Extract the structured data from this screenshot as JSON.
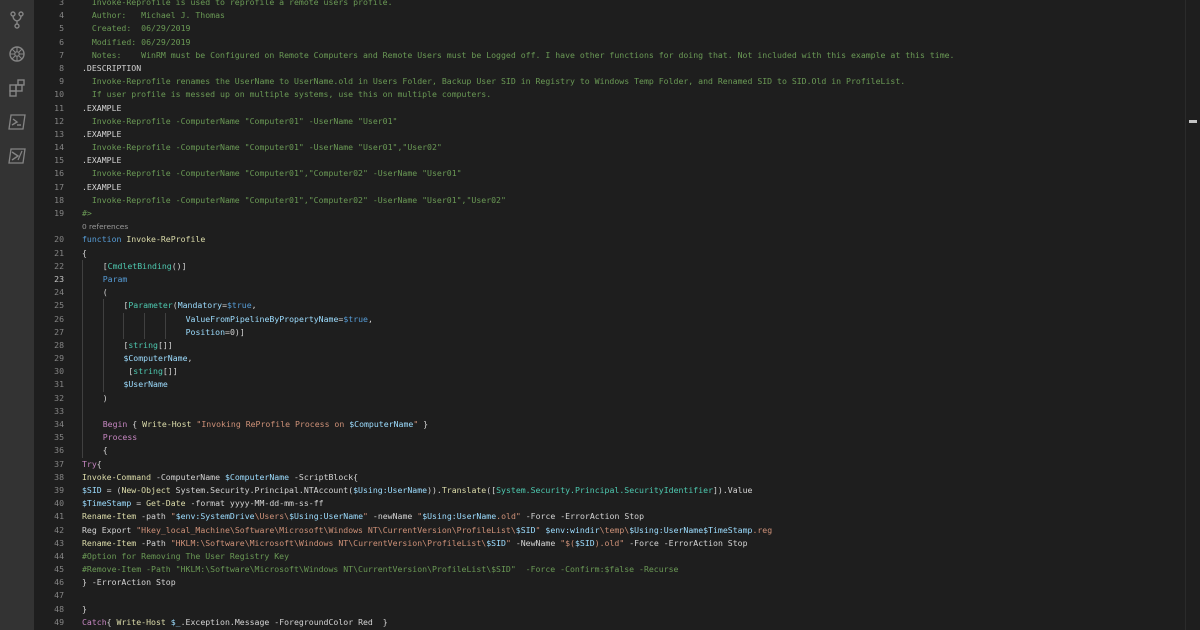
{
  "activity_bar": {
    "icons": [
      "source-control-icon",
      "debug-icon",
      "extensions-icon",
      "powershell-icon",
      "powershell-alt-icon"
    ]
  },
  "colors": {
    "background": "#1e1e1e",
    "comment": "#6a9955",
    "keyword": "#569cd6",
    "control": "#c586c0",
    "function": "#dcdcaa",
    "variable": "#9cdcfe",
    "string": "#ce9178",
    "type": "#4ec9b0"
  },
  "editor": {
    "active_line": "23",
    "codelens": "0 references",
    "lines": [
      {
        "n": "3",
        "t": [
          [
            "comment",
            "  Invoke-Reprofile is used to reprofile a remote users profile."
          ]
        ]
      },
      {
        "n": "4",
        "t": [
          [
            "comment",
            "  Author:   Michael J. Thomas"
          ]
        ]
      },
      {
        "n": "5",
        "t": [
          [
            "comment",
            "  Created:  06/29/2019"
          ]
        ]
      },
      {
        "n": "6",
        "t": [
          [
            "comment",
            "  Modified: 06/29/2019"
          ]
        ]
      },
      {
        "n": "7",
        "t": [
          [
            "comment",
            "  Notes:    WinRM must be Configured on Remote Computers and Remote Users must be Logged off. I have other functions for doing that. Not included with this example at this time."
          ]
        ]
      },
      {
        "n": "8",
        "t": [
          [
            "plain",
            ".DESCRIPTION"
          ]
        ]
      },
      {
        "n": "9",
        "t": [
          [
            "comment",
            "  Invoke-Reprofile renames the UserName to UserName.old in Users Folder, Backup User SID in Registry to Windows Temp Folder, and Renamed SID to SID.Old in ProfileList."
          ]
        ]
      },
      {
        "n": "10",
        "t": [
          [
            "comment",
            "  If user profile is messed up on multiple systems, use this on multiple computers."
          ]
        ]
      },
      {
        "n": "11",
        "t": [
          [
            "plain",
            ".EXAMPLE"
          ]
        ]
      },
      {
        "n": "12",
        "t": [
          [
            "comment",
            "  Invoke-Reprofile -ComputerName \"Computer01\" -UserName \"User01\""
          ]
        ]
      },
      {
        "n": "13",
        "t": [
          [
            "plain",
            ".EXAMPLE"
          ]
        ]
      },
      {
        "n": "14",
        "t": [
          [
            "comment",
            "  Invoke-Reprofile -ComputerName \"Computer01\" -UserName \"User01\",\"User02\""
          ]
        ]
      },
      {
        "n": "15",
        "t": [
          [
            "plain",
            ".EXAMPLE"
          ]
        ]
      },
      {
        "n": "16",
        "t": [
          [
            "comment",
            "  Invoke-Reprofile -ComputerName \"Computer01\",\"Computer02\" -UserName \"User01\""
          ]
        ]
      },
      {
        "n": "17",
        "t": [
          [
            "plain",
            ".EXAMPLE"
          ]
        ]
      },
      {
        "n": "18",
        "t": [
          [
            "comment",
            "  Invoke-Reprofile -ComputerName \"Computer01\",\"Computer02\" -UserName \"User01\",\"User02\""
          ]
        ]
      },
      {
        "n": "19",
        "t": [
          [
            "comment",
            "#>"
          ]
        ]
      },
      {
        "lens": true
      },
      {
        "n": "20",
        "t": [
          [
            "keyword",
            "function "
          ],
          [
            "function",
            "Invoke-ReProfile"
          ]
        ]
      },
      {
        "n": "21",
        "t": [
          [
            "plain",
            "{"
          ]
        ]
      },
      {
        "n": "22",
        "g": 1,
        "t": [
          [
            "plain",
            "["
          ],
          [
            "type",
            "CmdletBinding"
          ],
          [
            "plain",
            "()]"
          ]
        ]
      },
      {
        "n": "23",
        "g": 1,
        "t": [
          [
            "keyword",
            "Param"
          ]
        ]
      },
      {
        "n": "24",
        "g": 1,
        "t": [
          [
            "plain",
            "("
          ]
        ]
      },
      {
        "n": "25",
        "g": 2,
        "t": [
          [
            "plain",
            "["
          ],
          [
            "type",
            "Parameter"
          ],
          [
            "plain",
            "("
          ],
          [
            "variable",
            "Mandatory"
          ],
          [
            "plain",
            "="
          ],
          [
            "keyword",
            "$true"
          ],
          [
            "plain",
            ","
          ]
        ]
      },
      {
        "n": "26",
        "g": 5,
        "t": [
          [
            "variable",
            "ValueFromPipelineByPropertyName"
          ],
          [
            "plain",
            "="
          ],
          [
            "keyword",
            "$true"
          ],
          [
            "plain",
            ","
          ]
        ]
      },
      {
        "n": "27",
        "g": 5,
        "t": [
          [
            "variable",
            "Position"
          ],
          [
            "plain",
            "=0)]"
          ]
        ]
      },
      {
        "n": "28",
        "g": 2,
        "t": [
          [
            "plain",
            "["
          ],
          [
            "type",
            "string"
          ],
          [
            "plain",
            "[]]"
          ]
        ]
      },
      {
        "n": "29",
        "g": 2,
        "t": [
          [
            "variable",
            "$ComputerName"
          ],
          [
            "plain",
            ","
          ]
        ]
      },
      {
        "n": "30",
        "g": 2,
        "t": [
          [
            "plain",
            " ["
          ],
          [
            "type",
            "string"
          ],
          [
            "plain",
            "[]]"
          ]
        ]
      },
      {
        "n": "31",
        "g": 2,
        "t": [
          [
            "variable",
            "$UserName"
          ]
        ]
      },
      {
        "n": "32",
        "g": 1,
        "t": [
          [
            "plain",
            ")"
          ]
        ]
      },
      {
        "n": "33",
        "g": 1,
        "t": []
      },
      {
        "n": "34",
        "g": 1,
        "t": [
          [
            "control",
            "Begin"
          ],
          [
            "plain",
            " { "
          ],
          [
            "function",
            "Write-Host"
          ],
          [
            "plain",
            " "
          ],
          [
            "string",
            "\"Invoking ReProfile Process on "
          ],
          [
            "variable",
            "$ComputerName"
          ],
          [
            "string",
            "\""
          ],
          [
            "plain",
            " }"
          ]
        ]
      },
      {
        "n": "35",
        "g": 1,
        "t": [
          [
            "control",
            "Process"
          ]
        ]
      },
      {
        "n": "36",
        "g": 1,
        "t": [
          [
            "plain",
            "{"
          ]
        ]
      },
      {
        "n": "37",
        "t": [
          [
            "control",
            "Try"
          ],
          [
            "plain",
            "{"
          ]
        ]
      },
      {
        "n": "38",
        "t": [
          [
            "function",
            "Invoke-Command"
          ],
          [
            "plain",
            " -ComputerName "
          ],
          [
            "variable",
            "$ComputerName"
          ],
          [
            "plain",
            " -ScriptBlock{"
          ]
        ]
      },
      {
        "n": "39",
        "t": [
          [
            "variable",
            "$SID"
          ],
          [
            "plain",
            " = ("
          ],
          [
            "function",
            "New-Object"
          ],
          [
            "plain",
            " System.Security.Principal.NTAccount("
          ],
          [
            "variable",
            "$Using:UserName"
          ],
          [
            "plain",
            "))."
          ],
          [
            "function",
            "Translate"
          ],
          [
            "plain",
            "(["
          ],
          [
            "type",
            "System.Security.Principal.SecurityIdentifier"
          ],
          [
            "plain",
            "]).Value"
          ]
        ]
      },
      {
        "n": "40",
        "t": [
          [
            "variable",
            "$TimeStamp"
          ],
          [
            "plain",
            " = "
          ],
          [
            "function",
            "Get-Date"
          ],
          [
            "plain",
            " -format yyyy-MM-dd-mm-ss-ff"
          ]
        ]
      },
      {
        "n": "41",
        "t": [
          [
            "function",
            "Rename-Item"
          ],
          [
            "plain",
            " -path "
          ],
          [
            "string",
            "\""
          ],
          [
            "variable",
            "$env:SystemDrive"
          ],
          [
            "string",
            "\\Users\\"
          ],
          [
            "variable",
            "$Using:UserName"
          ],
          [
            "string",
            "\""
          ],
          [
            "plain",
            " -newName "
          ],
          [
            "string",
            "\""
          ],
          [
            "variable",
            "$Using:UserName"
          ],
          [
            "string",
            ".old\""
          ],
          [
            "plain",
            " -Force -ErrorAction Stop"
          ]
        ]
      },
      {
        "n": "42",
        "t": [
          [
            "plain",
            "Reg Export "
          ],
          [
            "string",
            "\"Hkey_local_Machine\\Software\\Microsoft\\Windows NT\\CurrentVersion\\ProfileList\\"
          ],
          [
            "variable",
            "$SID"
          ],
          [
            "string",
            "\""
          ],
          [
            "plain",
            " "
          ],
          [
            "variable",
            "$env:windir"
          ],
          [
            "string",
            "\\temp\\"
          ],
          [
            "variable",
            "$Using:UserName$TimeStamp"
          ],
          [
            "string",
            ".reg"
          ]
        ]
      },
      {
        "n": "43",
        "t": [
          [
            "function",
            "Rename-Item"
          ],
          [
            "plain",
            " -Path "
          ],
          [
            "string",
            "\"HKLM:\\Software\\Microsoft\\Windows NT\\CurrentVersion\\ProfileList\\"
          ],
          [
            "variable",
            "$SID"
          ],
          [
            "string",
            "\""
          ],
          [
            "plain",
            " -NewName "
          ],
          [
            "string",
            "\"$("
          ],
          [
            "variable",
            "$SID"
          ],
          [
            "string",
            ").old\""
          ],
          [
            "plain",
            " -Force -ErrorAction Stop"
          ]
        ]
      },
      {
        "n": "44",
        "t": [
          [
            "comment",
            "#Option for Removing The User Registry Key"
          ]
        ]
      },
      {
        "n": "45",
        "t": [
          [
            "comment",
            "#Remove-Item -Path \"HKLM:\\Software\\Microsoft\\Windows NT\\CurrentVersion\\ProfileList\\$SID\"  -Force -Confirm:$false -Recurse"
          ]
        ]
      },
      {
        "n": "46",
        "t": [
          [
            "plain",
            "} -ErrorAction Stop"
          ]
        ]
      },
      {
        "n": "47",
        "t": []
      },
      {
        "n": "48",
        "t": [
          [
            "plain",
            "}"
          ]
        ]
      },
      {
        "n": "49",
        "t": [
          [
            "control",
            "Catch"
          ],
          [
            "plain",
            "{ "
          ],
          [
            "function",
            "Write-Host"
          ],
          [
            "plain",
            " "
          ],
          [
            "variable",
            "$_"
          ],
          [
            "plain",
            ".Exception.Message -ForegroundColor Red  }"
          ]
        ]
      }
    ]
  }
}
